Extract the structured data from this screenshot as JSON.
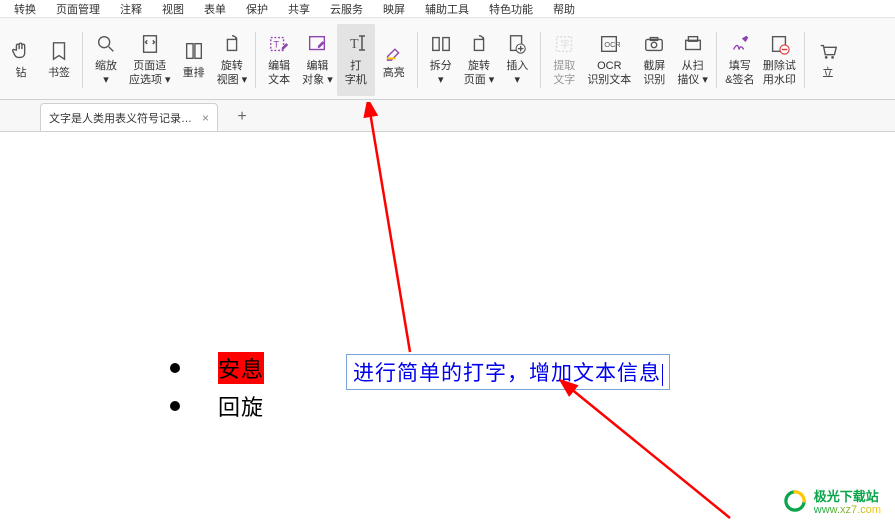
{
  "menu": [
    "转换",
    "页面管理",
    "注释",
    "视图",
    "表单",
    "保护",
    "共享",
    "云服务",
    "映屏",
    "辅助工具",
    "特色功能",
    "帮助"
  ],
  "ribbon": [
    {
      "id": "hand",
      "label1": "钻",
      "label2": "",
      "icon": "hand"
    },
    {
      "id": "bookmark",
      "label1": "书签",
      "label2": "",
      "icon": "bookmark",
      "sep_after": true
    },
    {
      "id": "zoom",
      "label1": "缩放",
      "label2": "",
      "icon": "zoom",
      "dd": true
    },
    {
      "id": "pageopt",
      "label1": "页面适",
      "label2": "应选项",
      "icon": "fit",
      "dd": true
    },
    {
      "id": "rearr",
      "label1": "重排",
      "label2": "",
      "icon": "reflow"
    },
    {
      "id": "rotview",
      "label1": "旋转",
      "label2": "视图",
      "icon": "rotate",
      "dd": true,
      "sep_after": true
    },
    {
      "id": "edittext",
      "label1": "编辑",
      "label2": "文本",
      "icon": "edittext"
    },
    {
      "id": "editobj",
      "label1": "编辑",
      "label2": "对象",
      "icon": "editobj",
      "dd": true
    },
    {
      "id": "typewriter",
      "label1": "打",
      "label2": "字机",
      "icon": "typewriter",
      "active": true
    },
    {
      "id": "highlight",
      "label1": "高亮",
      "label2": "",
      "icon": "hl",
      "sep_after": true
    },
    {
      "id": "split",
      "label1": "拆分",
      "label2": "",
      "icon": "split",
      "dd": true
    },
    {
      "id": "rotpage",
      "label1": "旋转",
      "label2": "页面",
      "icon": "rotate",
      "dd": true
    },
    {
      "id": "insert",
      "label1": "插入",
      "label2": "",
      "icon": "insert",
      "dd": true,
      "sep_after": true
    },
    {
      "id": "extract",
      "label1": "提取",
      "label2": "文字",
      "icon": "extract",
      "dim": true
    },
    {
      "id": "ocr",
      "label1": "OCR",
      "label2": "识别文本",
      "icon": "ocr"
    },
    {
      "id": "screenshot",
      "label1": "截屏",
      "label2": "识别",
      "icon": "shot"
    },
    {
      "id": "scan",
      "label1": "从扫",
      "label2": "描仪",
      "icon": "scan",
      "dd": true,
      "sep_after": true
    },
    {
      "id": "fillsign",
      "label1": "填写",
      "label2": "&签名",
      "icon": "sign"
    },
    {
      "id": "trywm",
      "label1": "删除试",
      "label2": "用水印",
      "icon": "wm",
      "sep_after": true
    },
    {
      "id": "more",
      "label1": "立",
      "label2": "",
      "icon": "cart"
    }
  ],
  "tab": {
    "title": "文字是人类用表义符号记录…",
    "close": "×",
    "add": "+"
  },
  "doc": {
    "bullets": [
      {
        "text": "安息",
        "hl": true
      },
      {
        "text": "回旋",
        "hl": false
      }
    ],
    "typed_text": "进行简单的打字，增加文本信息"
  },
  "watermark": {
    "cn": "极光下载站",
    "domain": "www.xz7.com"
  },
  "colors": {
    "arrow": "#ff0000",
    "typed_border": "#7aa5d6",
    "typed_text": "#0000ee",
    "highlight_bg": "#ff0000"
  }
}
